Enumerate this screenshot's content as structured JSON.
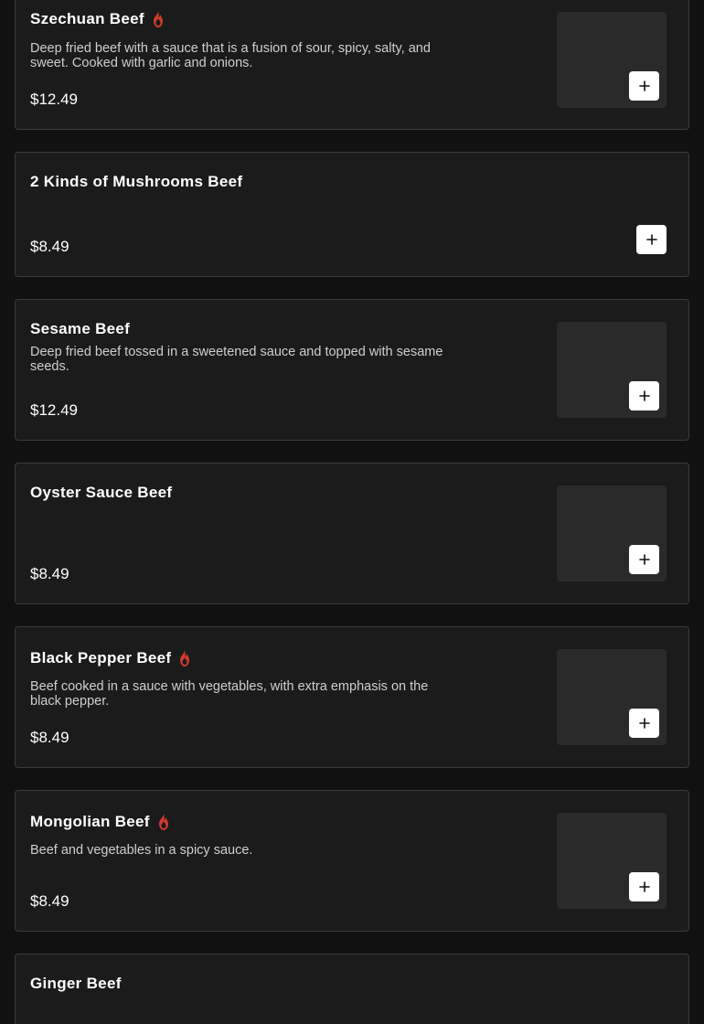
{
  "colors": {
    "page_background": "#111111",
    "card_background": "#1b1b1b",
    "card_border": "#3a3a3a",
    "image_placeholder": "#2a2a2a",
    "spicy_icon": "#d23a2a",
    "add_button": "#ffffff"
  },
  "items": [
    {
      "name": "Szechuan Beef",
      "spicy": true,
      "description": "Deep fried beef with a sauce that is a fusion of sour, spicy, salty, and sweet. Cooked with garlic and onions.",
      "price": "$12.49",
      "has_image": true
    },
    {
      "name": "2 Kinds of Mushrooms Beef",
      "spicy": false,
      "description": "",
      "price": "$8.49",
      "has_image": false
    },
    {
      "name": "Sesame Beef",
      "spicy": false,
      "description": "Deep fried beef tossed in a sweetened sauce and topped with sesame seeds.",
      "price": "$12.49",
      "has_image": true
    },
    {
      "name": "Oyster Sauce Beef",
      "spicy": false,
      "description": "",
      "price": "$8.49",
      "has_image": true
    },
    {
      "name": "Black Pepper Beef",
      "spicy": true,
      "description": "Beef cooked in a sauce with vegetables, with extra emphasis on the black pepper.",
      "price": "$8.49",
      "has_image": true
    },
    {
      "name": "Mongolian Beef",
      "spicy": true,
      "description": "Beef and vegetables in a spicy sauce.",
      "price": "$8.49",
      "has_image": true
    },
    {
      "name": "Ginger Beef",
      "spicy": false,
      "description": "",
      "price": "",
      "has_image": false
    }
  ],
  "icons": {
    "spicy": "fire-icon",
    "add": "plus-icon"
  }
}
